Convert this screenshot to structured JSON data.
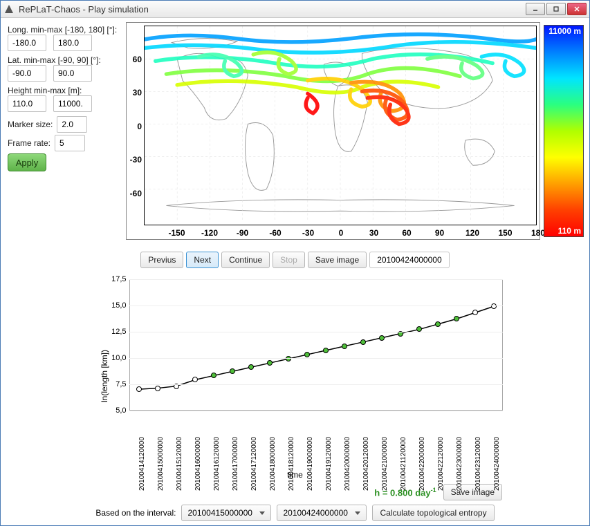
{
  "window": {
    "title": "RePLaT-Chaos - Play simulation"
  },
  "side": {
    "long_label": "Long. min-max [-180, 180] [°]:",
    "long_min": "-180.0",
    "long_max": "180.0",
    "lat_label": "Lat. min-max [-90, 90] [°]:",
    "lat_min": "-90.0",
    "lat_max": "90.0",
    "height_label": "Height min-max [m]:",
    "height_min": "110.0",
    "height_max": "11000.",
    "marker_label": "Marker size:",
    "marker_val": "2.0",
    "framerate_label": "Frame rate:",
    "framerate_val": "5",
    "apply": "Apply"
  },
  "colorbar": {
    "top": "11000 m",
    "bottom": "110 m"
  },
  "map_ticks": {
    "y": [
      "60",
      "30",
      "0",
      "-30",
      "-60"
    ],
    "x": [
      "-150",
      "-120",
      "-90",
      "-60",
      "-30",
      "0",
      "30",
      "60",
      "90",
      "120",
      "150",
      "180"
    ]
  },
  "playback": {
    "prev": "Previus",
    "next": "Next",
    "cont": "Continue",
    "stop": "Stop",
    "save": "Save image",
    "timestamp": "20100424000000"
  },
  "chart": {
    "ylabel": "ln(length [km])",
    "xlabel": "time"
  },
  "chart_data": {
    "type": "scatter",
    "title": "",
    "xlabel": "time",
    "ylabel": "ln(length [km])",
    "ylim": [
      5.0,
      17.5
    ],
    "yticks": [
      5.0,
      7.5,
      10.0,
      12.5,
      15.0,
      17.5
    ],
    "x": [
      "20100414120000",
      "20100415000000",
      "20100415120000",
      "20100416000000",
      "20100416120000",
      "20100417000000",
      "20100417120000",
      "20100418000000",
      "20100418120000",
      "20100419000000",
      "20100419120000",
      "20100420000000",
      "20100420120000",
      "20100421000000",
      "20100421120000",
      "20100422000000",
      "20100422120000",
      "20100423000000",
      "20100423120000",
      "20100424000000"
    ],
    "values": [
      7.1,
      7.2,
      7.4,
      8.0,
      8.4,
      8.8,
      9.2,
      9.6,
      10.0,
      10.4,
      10.8,
      11.2,
      11.6,
      12.0,
      12.4,
      12.8,
      13.3,
      13.8,
      14.4,
      15.0
    ]
  },
  "entropy": {
    "label": "h = 0.800 day",
    "sup": "-1",
    "save": "Save image"
  },
  "interval": {
    "label": "Based on the interval:",
    "from": "20100415000000",
    "to": "20100424000000",
    "calc": "Calculate topological entropy"
  }
}
